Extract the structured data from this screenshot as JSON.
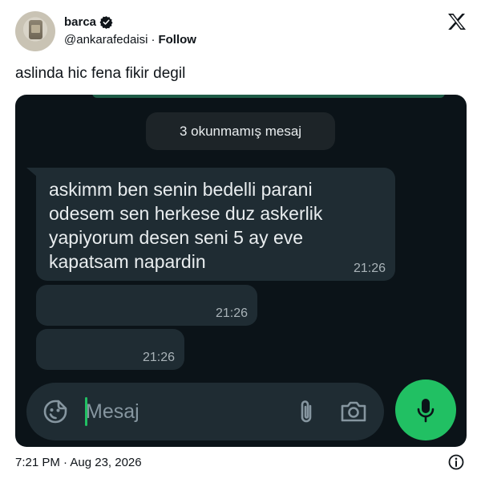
{
  "tweet": {
    "author_name": "barca",
    "handle": "@ankarafedaisi",
    "separator": "·",
    "follow_label": "Follow",
    "text": "aslinda hic fena fikir degil",
    "timestamp": "7:21 PM · Aug 23, 2026"
  },
  "chat": {
    "unread_label": "3 okunmamış mesaj",
    "messages": [
      {
        "text": "askimm ben senin bedelli parani odesem sen herkese duz askerlik yapiyorum desen seni 5 ay eve kapatsam napardin",
        "time": "21:26"
      },
      {
        "text": "",
        "time": "21:26"
      },
      {
        "text": "",
        "time": "21:26"
      }
    ],
    "input_placeholder": "Mesaj"
  },
  "icons": {
    "verified": "verified-badge-icon",
    "brand": "x-logo-icon",
    "emoji": "sticker-emoji-icon",
    "attach": "paperclip-icon",
    "camera": "camera-icon",
    "mic": "microphone-icon",
    "info": "info-icon"
  },
  "colors": {
    "chat_bg": "#0b1318",
    "bubble": "#1f2c33",
    "accent_green": "#21c063",
    "text_light": "#e9edef"
  }
}
